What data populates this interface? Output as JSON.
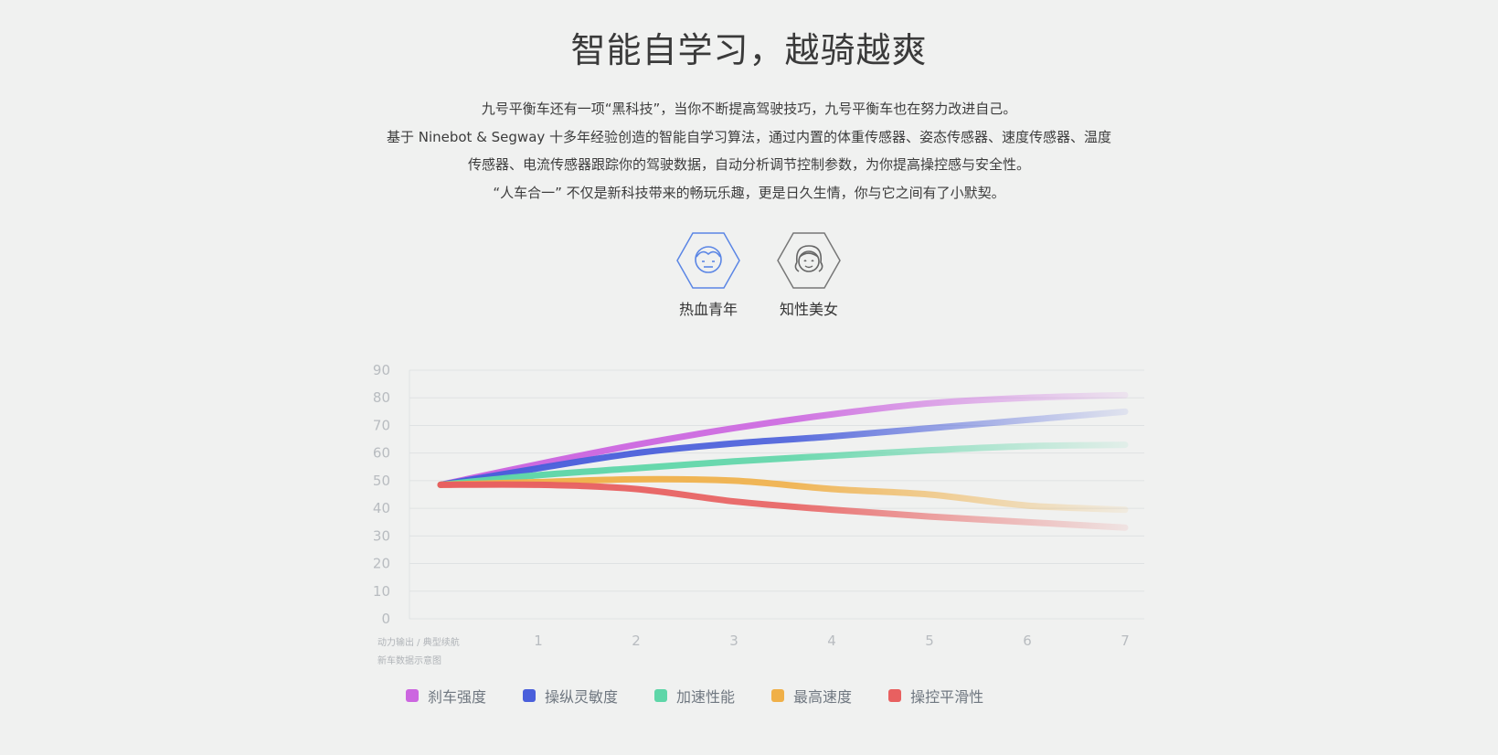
{
  "page": {
    "title": "智能自学习，越骑越爽",
    "description": [
      "九号平衡车还有一项“黑科技”，当你不断提高驾驶技巧，九号平衡车也在努力改进自己。",
      "基于 Ninebot & Segway 十多年经验创造的智能自学习算法，通过内置的体重传感器、姿态传感器、速度传感器、温度",
      "传感器、电流传感器跟踪你的驾驶数据，自动分析调节控制参数，为你提高操控感与安全性。",
      "“人车合一” 不仅是新科技带来的畅玩乐趣，更是日久生情，你与它之间有了小默契。"
    ]
  },
  "personas": [
    {
      "label": "热血青年",
      "icon": "young-man-icon",
      "selected": true,
      "color": "#5b86e5"
    },
    {
      "label": "知性美女",
      "icon": "young-woman-icon",
      "selected": false,
      "color": "#777777"
    }
  ],
  "chart_data": {
    "type": "line",
    "title": "",
    "xlabel": "动力输出 / 典型续航",
    "caption": "新车数据示意图",
    "x": [
      0,
      1,
      2,
      3,
      4,
      5,
      6,
      7
    ],
    "x_tick_labels": [
      "1",
      "2",
      "3",
      "4",
      "5",
      "6",
      "7"
    ],
    "ylim": [
      0,
      90
    ],
    "y_ticks": [
      0,
      10,
      20,
      30,
      40,
      50,
      60,
      70,
      80,
      90
    ],
    "grid": true,
    "legend_position": "bottom-left",
    "series": [
      {
        "name": "刹车强度",
        "color": "#cc66e0",
        "values": [
          48.5,
          56,
          63,
          69,
          74,
          78,
          80,
          81
        ]
      },
      {
        "name": "操纵灵敏度",
        "color": "#4a5fdb",
        "values": [
          48.5,
          54.5,
          60,
          63.5,
          66,
          69,
          72,
          75
        ]
      },
      {
        "name": "加速性能",
        "color": "#5ed6a8",
        "values": [
          48.5,
          52,
          54.5,
          57,
          59,
          61,
          62.5,
          63
        ]
      },
      {
        "name": "最高速度",
        "color": "#f0b048",
        "values": [
          48.5,
          49.5,
          50.5,
          50,
          47,
          45,
          41,
          39.5
        ]
      },
      {
        "name": "操控平滑性",
        "color": "#e86060",
        "values": [
          48.5,
          48.5,
          47,
          42.5,
          39.5,
          37,
          35,
          33
        ]
      }
    ]
  }
}
